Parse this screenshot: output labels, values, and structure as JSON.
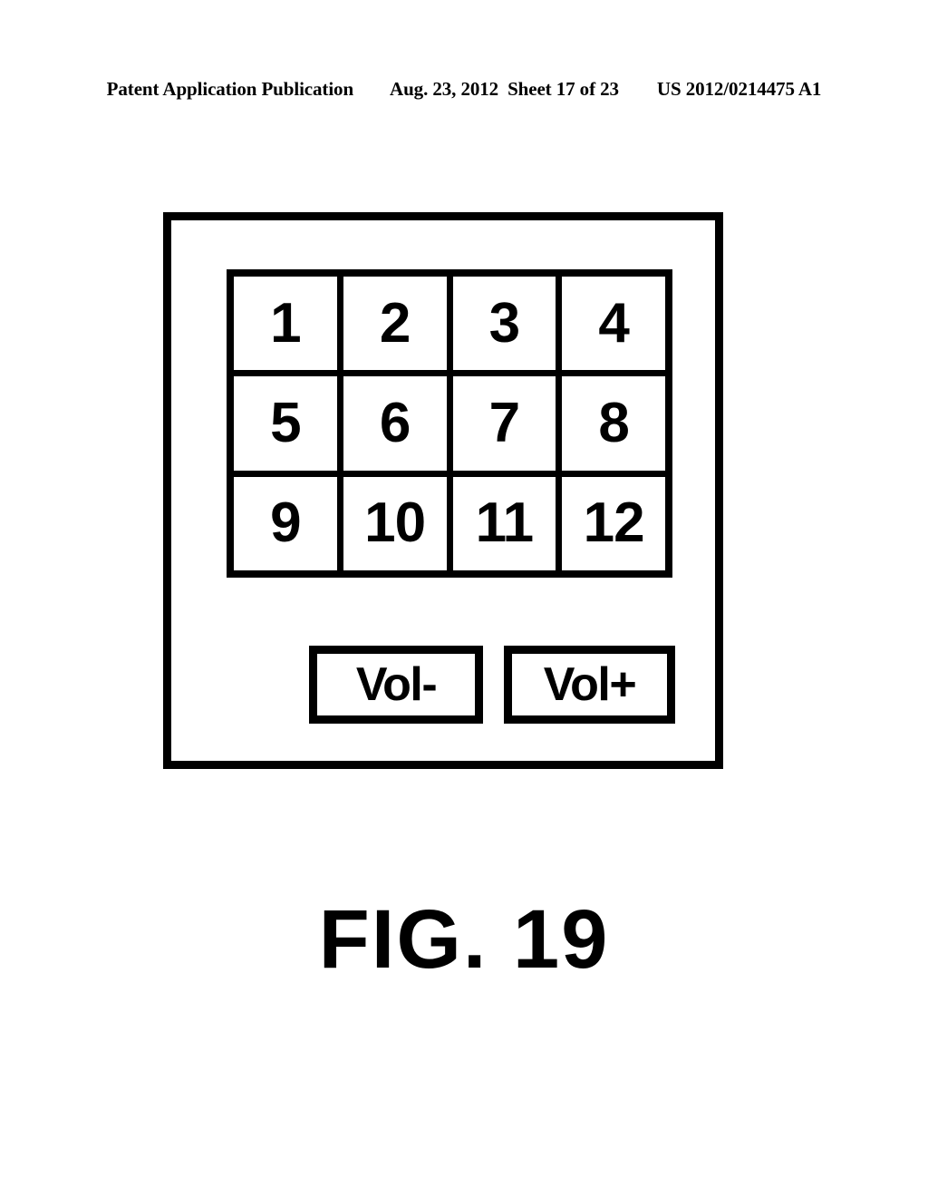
{
  "header": {
    "publication": "Patent Application Publication",
    "date": "Aug. 23, 2012",
    "sheet": "Sheet 17 of 23",
    "publication_number": "US 2012/0214475 A1"
  },
  "figure": {
    "caption": "FIG. 19",
    "device": {
      "keypad": {
        "rows": 3,
        "columns": 4,
        "keys": [
          {
            "label": "1"
          },
          {
            "label": "2"
          },
          {
            "label": "3"
          },
          {
            "label": "4"
          },
          {
            "label": "5"
          },
          {
            "label": "6"
          },
          {
            "label": "7"
          },
          {
            "label": "8"
          },
          {
            "label": "9"
          },
          {
            "label": "10"
          },
          {
            "label": "11"
          },
          {
            "label": "12"
          }
        ]
      },
      "volume_controls": {
        "decrease_label": "Vol-",
        "increase_label": "Vol+"
      }
    }
  },
  "colors": {
    "ink": "#000000",
    "paper": "#ffffff"
  }
}
